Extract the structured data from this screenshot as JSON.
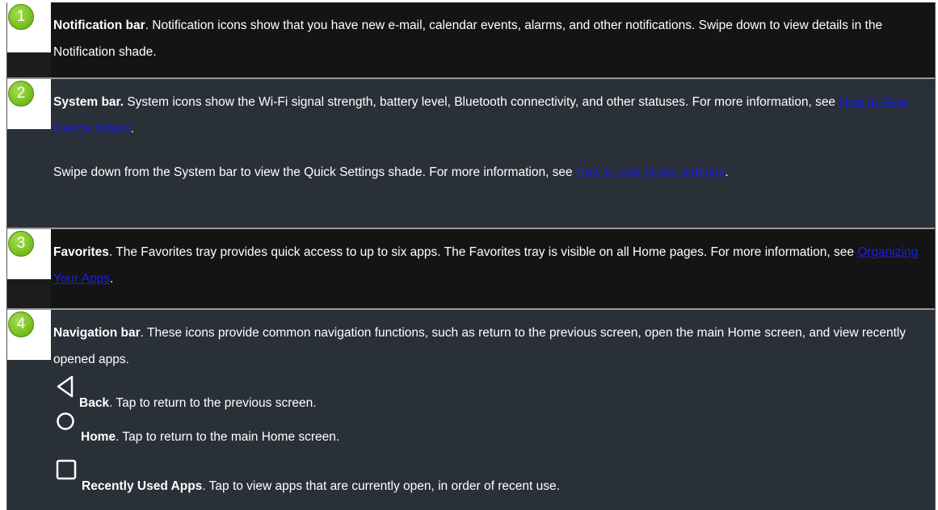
{
  "rows": [
    {
      "number": "1",
      "title": "Notification bar",
      "text": ". Notification icons show that you have new e-mail, calendar events, alarms, and other notifications. Swipe down to view details in the Notification shade."
    },
    {
      "number": "2",
      "title": "System bar.",
      "text": " System icons show the Wi-Fi signal strength, battery level, Bluetooth connectivity, and other statuses. For more information, see ",
      "link": "How to View Device Status",
      "after": ".",
      "para2_text": "Swipe down from the System bar to view the Quick Settings shade. For more information, see ",
      "para2_link": "How to Use Quick Settings",
      "para2_after": "."
    },
    {
      "number": "3",
      "title": "Favorites",
      "text": ". The Favorites tray provides quick access to up to six apps. The Favorites tray is visible on all Home pages. For more information, see ",
      "link": "Organizing Your Apps",
      "after": "."
    },
    {
      "number": "4",
      "title": "Navigation bar",
      "text": ". These icons provide common navigation functions, such as return to the previous screen, open the main Home screen, and view recently opened apps.",
      "items": [
        {
          "icon": "back-icon",
          "title": "Back",
          "text": ". Tap to return to the previous screen."
        },
        {
          "icon": "home-icon",
          "title": "Home",
          "text": ". Tap to return to the main Home screen."
        },
        {
          "icon": "recents-icon",
          "title": "Recently Used Apps",
          "text": ". Tap to view apps that are currently open, in order of recent use."
        }
      ]
    }
  ],
  "colors": {
    "row_dark": "#141414",
    "row_slate": "#2a3037",
    "badge_green": "#7cc424",
    "link": "#1a1fe6"
  }
}
